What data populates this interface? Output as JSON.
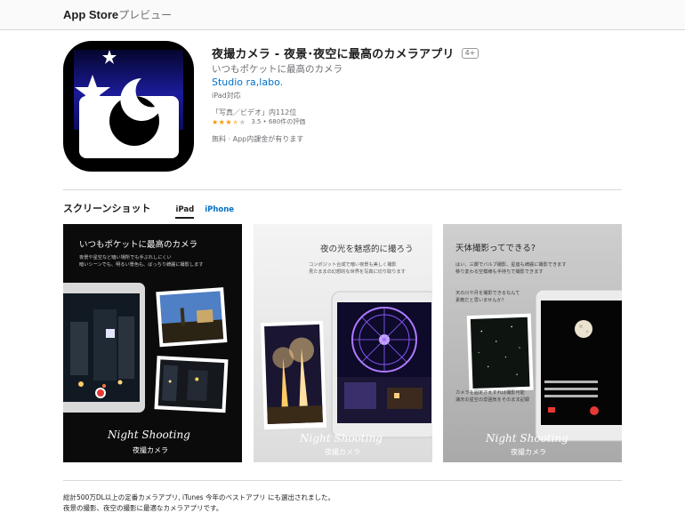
{
  "header": {
    "brand": "App Store",
    "brand_suffix": "プレビュー"
  },
  "app": {
    "title": "夜撮カメラ - 夜景･夜空に最高のカメラアプリ",
    "age_rating": "4+",
    "subtitle": "いつもポケットに最高のカメラ",
    "developer": "Studio ra,labo.",
    "compatibility": "iPad対応",
    "ranking": "「写真／ビデオ」内112位",
    "rating_value": "3.5",
    "rating_count": "• 680件の評価",
    "rating_stars": 3.5,
    "price": "無料 · App内課金が有ります"
  },
  "screenshots": {
    "title": "スクリーンショット",
    "tabs": [
      {
        "label": "iPad"
      },
      {
        "label": "iPhone"
      }
    ],
    "items": [
      {
        "heading": "いつもポケットに最高のカメラ",
        "body": "夜景や星空など暗い場所でも手ぶれしにくい\n暗いシーンでも、明るい景色も、ばっちり綺麗に撮影します",
        "signature": "Night Shooting",
        "signature_sub": "夜撮カメラ"
      },
      {
        "heading": "夜の光を魅惑的に撮ろう",
        "body": "コンポジット合成で暗い夜景も美しく撮影\n見たままの幻想的な世界を写真に切り取ります",
        "signature": "Night Shooting",
        "signature_sub": "夜撮カメラ"
      },
      {
        "heading": "天体撮影ってできる?",
        "body": "はい、三脚でバルブ撮影、星座も綺麗に撮影できます\n移り変わる空模様も手持ちで撮影できます",
        "body2": "天の川や月を撮影できるなんて\n素敵だと思いませんか？",
        "body3": "カメラを固定さえすれば撮影可能\n満天の星空の雰囲気をそのまま記録",
        "signature": "Night Shooting",
        "signature_sub": "夜撮カメラ"
      }
    ]
  },
  "description": {
    "line1": "総計500万DL以上の定番カメラアプリ, iTunes 今年のベストアプリ にも選出されました。",
    "line2": "夜景の撮影、夜空の撮影に最適なカメラアプリです。"
  },
  "colors": {
    "link": "#0070c9",
    "star": "#ff9500",
    "icon_bg": "#0c0e4a"
  }
}
